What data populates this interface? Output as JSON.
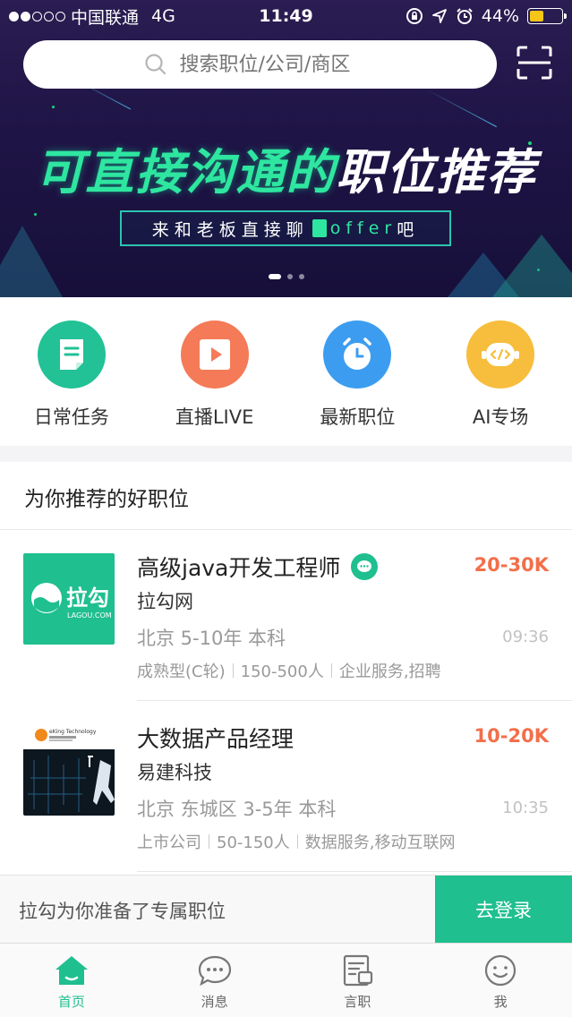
{
  "status_bar": {
    "carrier": "中国联通",
    "network": "4G",
    "time": "11:49",
    "battery": "44%",
    "battery_level": 0.44
  },
  "search": {
    "placeholder": "搜索职位/公司/商区"
  },
  "banner": {
    "title_green": "可直接沟通的",
    "title_white": "职位推荐",
    "subtitle_pre": "来和老板直接聊",
    "subtitle_offer": "offer",
    "subtitle_post": "吧",
    "pages": 3,
    "active_page": 1
  },
  "quick_entries": [
    {
      "label": "日常任务",
      "color": "#22c196",
      "icon": "task-icon"
    },
    {
      "label": "直播LIVE",
      "color": "#f47a58",
      "icon": "play-icon"
    },
    {
      "label": "最新职位",
      "color": "#3c9df0",
      "icon": "clock-icon"
    },
    {
      "label": "AI专场",
      "color": "#f7bd3c",
      "icon": "robot-icon"
    }
  ],
  "section_title": "为你推荐的好职位",
  "jobs": [
    {
      "title": "高级java开发工程师",
      "salary": "20-30K",
      "company": "拉勾网",
      "meta": "北京 5-10年 本科",
      "time": "09:36",
      "tags": [
        "成熟型(C轮)",
        "150-500人",
        "企业服务,招聘"
      ],
      "logo_text": "拉勾",
      "logo_sub": "LAGOU.COM"
    },
    {
      "title": "大数据产品经理",
      "salary": "10-20K",
      "company": "易建科技",
      "meta": "北京 东城区 3-5年 本科",
      "time": "10:35",
      "tags": [
        "上市公司",
        "50-150人",
        "数据服务,移动互联网"
      ],
      "logo_text": "eKing Technology"
    }
  ],
  "login_bar": {
    "text": "拉勾为你准备了专属职位",
    "button": "去登录"
  },
  "tabbar": [
    {
      "label": "首页",
      "icon": "home-icon",
      "active": true
    },
    {
      "label": "消息",
      "icon": "message-icon",
      "active": false
    },
    {
      "label": "言职",
      "icon": "document-icon",
      "active": false
    },
    {
      "label": "我",
      "icon": "smiley-icon",
      "active": false
    }
  ],
  "colors": {
    "brand": "#1fbf8f",
    "salary": "#f26f4a",
    "banner_bg": "#1f1446"
  }
}
